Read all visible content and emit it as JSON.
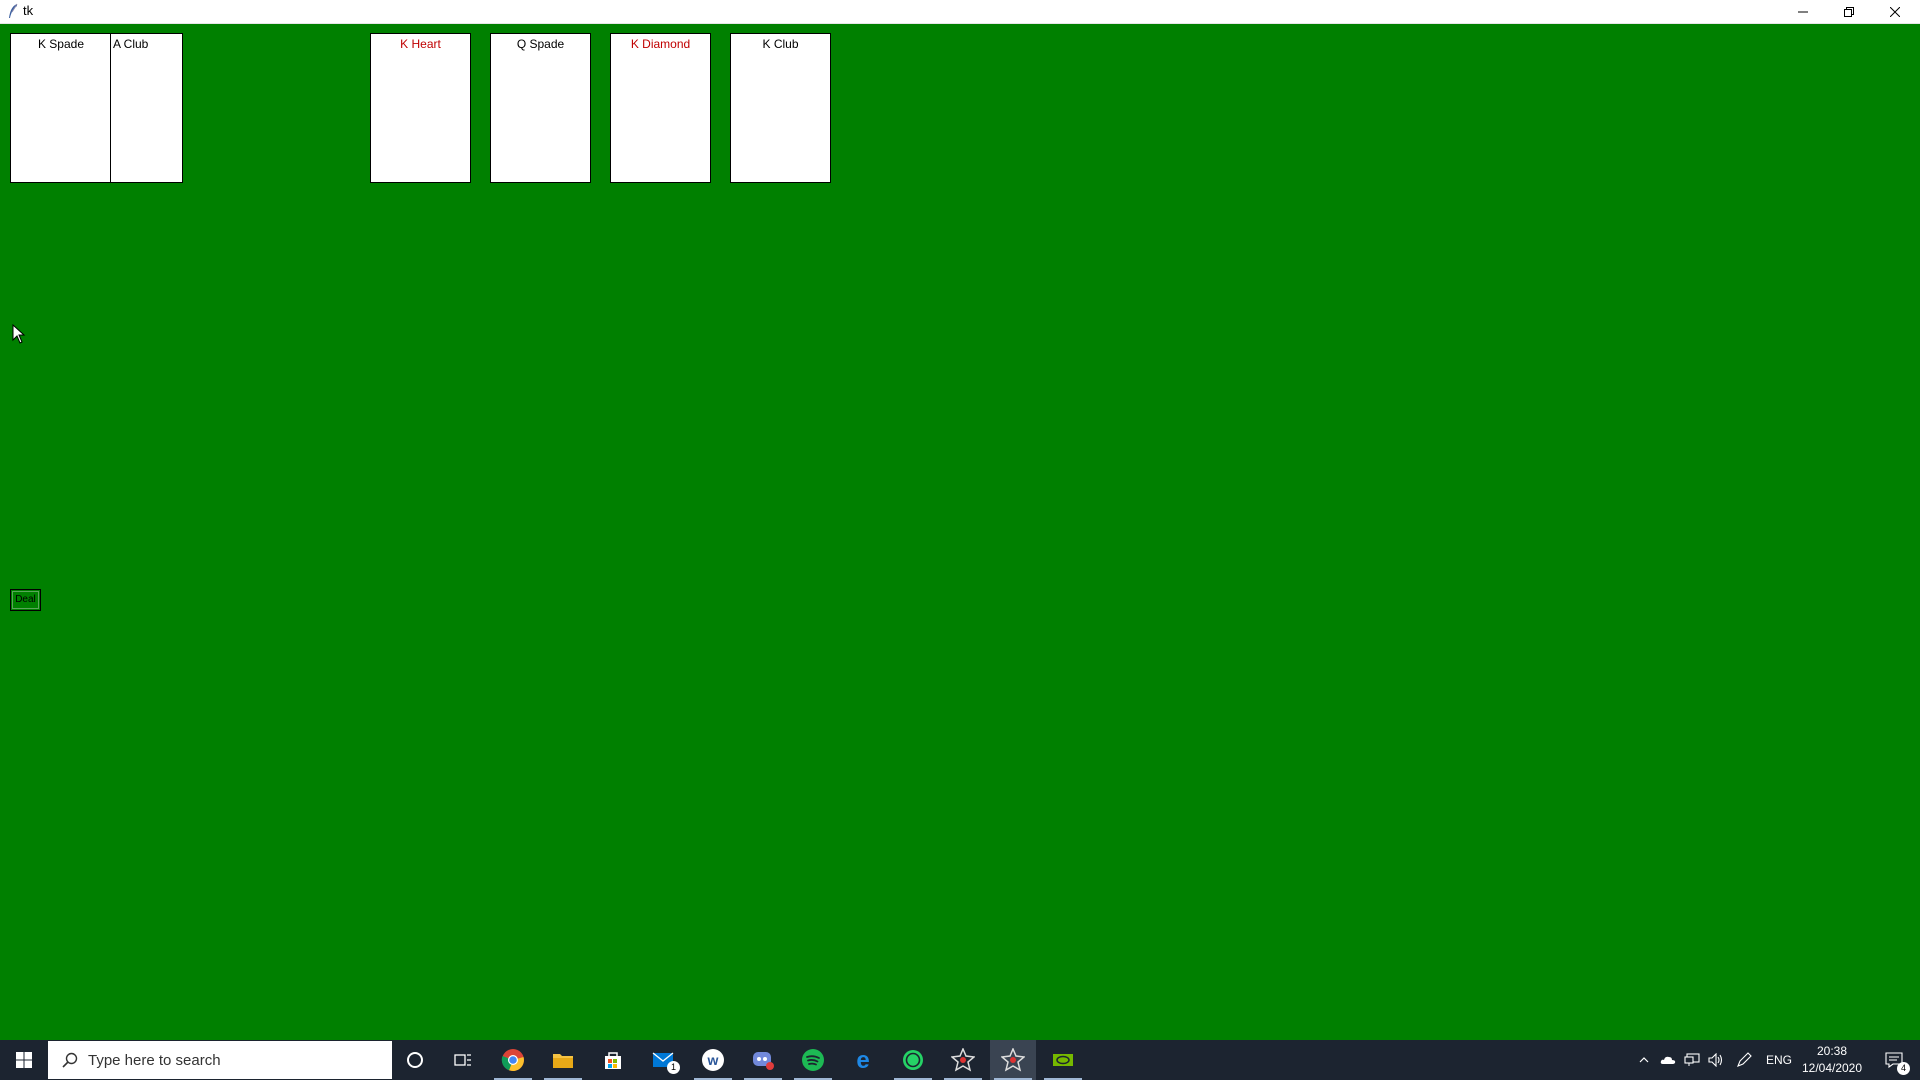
{
  "window": {
    "title": "tk",
    "minimize": "minimize",
    "maximize": "restore",
    "close": "close"
  },
  "colors": {
    "felt": "#008000",
    "card_face": "#ffffff",
    "red_suit": "#c00000",
    "black_suit": "#000000"
  },
  "stock_pile": [
    {
      "label": "K  Spade",
      "suit_color": "black"
    },
    {
      "label": "A  Club",
      "suit_color": "black"
    }
  ],
  "tableau": [
    {
      "label": "K  Heart",
      "suit_color": "red"
    },
    {
      "label": "Q  Spade",
      "suit_color": "black"
    },
    {
      "label": "K  Diamond",
      "suit_color": "red"
    },
    {
      "label": "K  Club",
      "suit_color": "black"
    }
  ],
  "controls": {
    "deal_label": "Deal"
  },
  "taskbar": {
    "search_placeholder": "Type here to search",
    "apps": [
      {
        "icon": "cortana-icon"
      },
      {
        "icon": "task-view-icon"
      },
      {
        "icon": "chrome-icon"
      },
      {
        "icon": "file-explorer-icon"
      },
      {
        "icon": "store-icon"
      },
      {
        "icon": "mail-icon",
        "badge": "1"
      },
      {
        "icon": "word-icon"
      },
      {
        "icon": "discord-icon"
      },
      {
        "icon": "spotify-icon"
      },
      {
        "icon": "edge-icon"
      },
      {
        "icon": "whatsapp-icon"
      },
      {
        "icon": "python-settings-icon"
      },
      {
        "icon": "python-settings-icon"
      },
      {
        "icon": "nvidia-icon"
      }
    ],
    "tray": {
      "language": "ENG",
      "time": "20:38",
      "date": "12/04/2020",
      "notifications_badge": "4"
    }
  }
}
